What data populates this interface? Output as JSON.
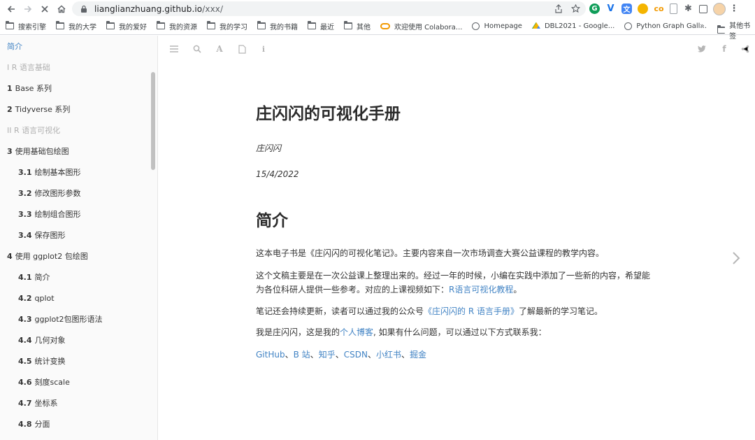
{
  "browser": {
    "url_host": "lianglianzhuang.github.io",
    "url_path": "/xxx/",
    "bookmarks": [
      {
        "label": "搜索引擎",
        "icon": "folder-icon"
      },
      {
        "label": "我的大学",
        "icon": "folder-icon"
      },
      {
        "label": "我的爱好",
        "icon": "folder-icon"
      },
      {
        "label": "我的资源",
        "icon": "folder-icon"
      },
      {
        "label": "我的学习",
        "icon": "folder-icon"
      },
      {
        "label": "我的书籍",
        "icon": "folder-icon"
      },
      {
        "label": "最近",
        "icon": "folder-icon"
      },
      {
        "label": "其他",
        "icon": "folder-icon"
      },
      {
        "label": "欢迎使用 Colabora...",
        "icon": "colab-icon"
      },
      {
        "label": "Homepage",
        "icon": "globe-icon"
      },
      {
        "label": "DBL2021 - Google...",
        "icon": "drive-icon"
      },
      {
        "label": "Python Graph Gall...",
        "icon": "globe-icon"
      }
    ],
    "bookmarks_more": "»",
    "other_bookmarks": "其他书签"
  },
  "sidebar": {
    "items": [
      {
        "num": "",
        "label": "简介",
        "kind": "active"
      },
      {
        "num": "",
        "label": "I R 语言基础",
        "kind": "part"
      },
      {
        "num": "1",
        "label": "Base 系列",
        "kind": "chapter"
      },
      {
        "num": "2",
        "label": "Tidyverse 系列",
        "kind": "chapter"
      },
      {
        "num": "",
        "label": "II R 语言可视化",
        "kind": "part"
      },
      {
        "num": "3",
        "label": "使用基础包绘图",
        "kind": "chapter"
      },
      {
        "num": "3.1",
        "label": "绘制基本图形",
        "kind": "sub"
      },
      {
        "num": "3.2",
        "label": "修改图形参数",
        "kind": "sub"
      },
      {
        "num": "3.3",
        "label": "绘制组合图形",
        "kind": "sub"
      },
      {
        "num": "3.4",
        "label": "保存图形",
        "kind": "sub"
      },
      {
        "num": "4",
        "label": "使用 ggplot2 包绘图",
        "kind": "chapter"
      },
      {
        "num": "4.1",
        "label": "简介",
        "kind": "sub"
      },
      {
        "num": "4.2",
        "label": "qplot",
        "kind": "sub"
      },
      {
        "num": "4.3",
        "label": "ggplot2包图形语法",
        "kind": "sub"
      },
      {
        "num": "4.4",
        "label": "几何对象",
        "kind": "sub"
      },
      {
        "num": "4.5",
        "label": "统计变换",
        "kind": "sub"
      },
      {
        "num": "4.6",
        "label": "刻度scale",
        "kind": "sub"
      },
      {
        "num": "4.7",
        "label": "坐标系",
        "kind": "sub"
      },
      {
        "num": "4.8",
        "label": "分面",
        "kind": "sub"
      }
    ]
  },
  "main": {
    "title": "庄闪闪的可视化手册",
    "author": "庄闪闪",
    "date": "15/4/2022",
    "section_heading": "简介",
    "p1": "这本电子书是《庄闪闪的可视化笔记》。主要内容来自一次市场调查大赛公益课程的教学内容。",
    "p2_a": "这个文稿主要是在一次公益课上整理出来的。经过一年的时候，小编在实践中添加了一些新的内容，希望能",
    "p2_b": "为各位科研人提供一些参考。对应的上课视频如下：",
    "p2_link": "R语言可视化教程",
    "p2_end": "。",
    "p3_a": "笔记还会持续更新，读者可以通过我的公众号",
    "p3_link": "《庄闪闪的 R 语言手册》",
    "p3_b": "了解最新的学习笔记。",
    "p4_a": "我是庄闪闪，这是我的",
    "p4_link": "个人博客",
    "p4_b": ", 如果有什么问题，可以通过以下方式联系我：",
    "contacts": [
      "GitHub",
      "B 站",
      "知乎",
      "CSDN",
      "小红书",
      "掘金"
    ],
    "contact_sep": "、"
  }
}
